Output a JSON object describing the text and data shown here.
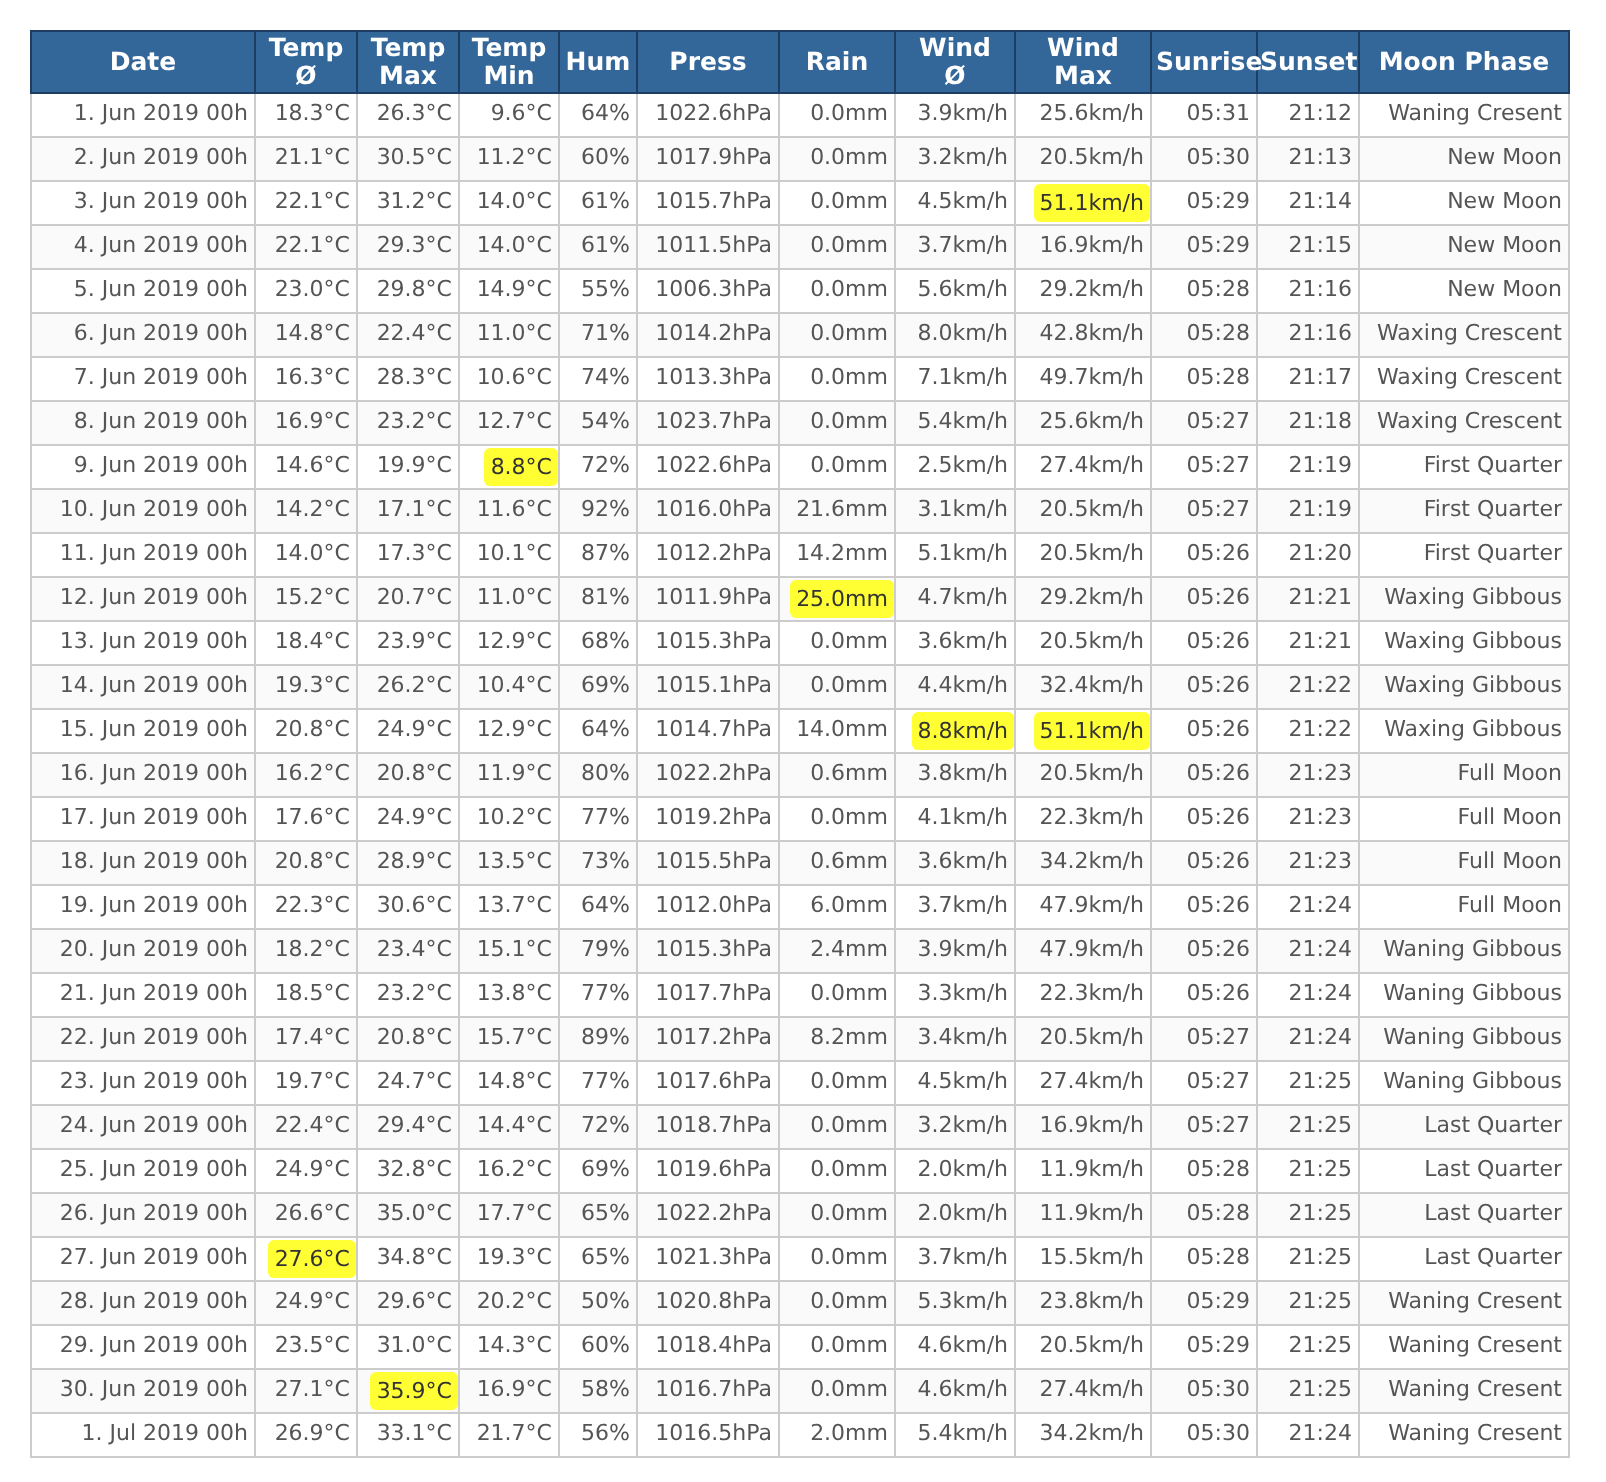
{
  "table": {
    "columns": [
      "Date",
      "Temp Ø",
      "Temp Max",
      "Temp Min",
      "Hum",
      "Press",
      "Rain",
      "Wind Ø",
      "Wind Max",
      "Sunrise",
      "Sunset",
      "Moon Phase"
    ],
    "rows": [
      {
        "cells": [
          "1. Jun 2019 00h",
          "18.3°C",
          "26.3°C",
          "9.6°C",
          "64%",
          "1022.6hPa",
          "0.0mm",
          "3.9km/h",
          "25.6km/h",
          "05:31",
          "21:12",
          "Waning Cresent"
        ]
      },
      {
        "cells": [
          "2. Jun 2019 00h",
          "21.1°C",
          "30.5°C",
          "11.2°C",
          "60%",
          "1017.9hPa",
          "0.0mm",
          "3.2km/h",
          "20.5km/h",
          "05:30",
          "21:13",
          "New Moon"
        ]
      },
      {
        "cells": [
          "3. Jun 2019 00h",
          "22.1°C",
          "31.2°C",
          "14.0°C",
          "61%",
          "1015.7hPa",
          "0.0mm",
          "4.5km/h",
          {
            "text": "51.1km/h",
            "highlighted": true
          },
          "05:29",
          "21:14",
          "New Moon"
        ]
      },
      {
        "cells": [
          "4. Jun 2019 00h",
          "22.1°C",
          "29.3°C",
          "14.0°C",
          "61%",
          "1011.5hPa",
          "0.0mm",
          "3.7km/h",
          "16.9km/h",
          "05:29",
          "21:15",
          "New Moon"
        ]
      },
      {
        "cells": [
          "5. Jun 2019 00h",
          "23.0°C",
          "29.8°C",
          "14.9°C",
          "55%",
          "1006.3hPa",
          "0.0mm",
          "5.6km/h",
          "29.2km/h",
          "05:28",
          "21:16",
          "New Moon"
        ]
      },
      {
        "cells": [
          "6. Jun 2019 00h",
          "14.8°C",
          "22.4°C",
          "11.0°C",
          "71%",
          "1014.2hPa",
          "0.0mm",
          "8.0km/h",
          "42.8km/h",
          "05:28",
          "21:16",
          "Waxing Crescent"
        ]
      },
      {
        "cells": [
          "7. Jun 2019 00h",
          "16.3°C",
          "28.3°C",
          "10.6°C",
          "74%",
          "1013.3hPa",
          "0.0mm",
          "7.1km/h",
          "49.7km/h",
          "05:28",
          "21:17",
          "Waxing Crescent"
        ]
      },
      {
        "cells": [
          "8. Jun 2019 00h",
          "16.9°C",
          "23.2°C",
          "12.7°C",
          "54%",
          "1023.7hPa",
          "0.0mm",
          "5.4km/h",
          "25.6km/h",
          "05:27",
          "21:18",
          "Waxing Crescent"
        ]
      },
      {
        "cells": [
          "9. Jun 2019 00h",
          "14.6°C",
          "19.9°C",
          {
            "text": "8.8°C",
            "highlighted": true
          },
          "72%",
          "1022.6hPa",
          "0.0mm",
          "2.5km/h",
          "27.4km/h",
          "05:27",
          "21:19",
          "First Quarter"
        ]
      },
      {
        "cells": [
          "10. Jun 2019 00h",
          "14.2°C",
          "17.1°C",
          "11.6°C",
          "92%",
          "1016.0hPa",
          "21.6mm",
          "3.1km/h",
          "20.5km/h",
          "05:27",
          "21:19",
          "First Quarter"
        ]
      },
      {
        "cells": [
          "11. Jun 2019 00h",
          "14.0°C",
          "17.3°C",
          "10.1°C",
          "87%",
          "1012.2hPa",
          "14.2mm",
          "5.1km/h",
          "20.5km/h",
          "05:26",
          "21:20",
          "First Quarter"
        ]
      },
      {
        "cells": [
          "12. Jun 2019 00h",
          "15.2°C",
          "20.7°C",
          "11.0°C",
          "81%",
          "1011.9hPa",
          {
            "text": "25.0mm",
            "highlighted": true
          },
          "4.7km/h",
          "29.2km/h",
          "05:26",
          "21:21",
          "Waxing Gibbous"
        ]
      },
      {
        "cells": [
          "13. Jun 2019 00h",
          "18.4°C",
          "23.9°C",
          "12.9°C",
          "68%",
          "1015.3hPa",
          "0.0mm",
          "3.6km/h",
          "20.5km/h",
          "05:26",
          "21:21",
          "Waxing Gibbous"
        ]
      },
      {
        "cells": [
          "14. Jun 2019 00h",
          "19.3°C",
          "26.2°C",
          "10.4°C",
          "69%",
          "1015.1hPa",
          "0.0mm",
          "4.4km/h",
          "32.4km/h",
          "05:26",
          "21:22",
          "Waxing Gibbous"
        ]
      },
      {
        "cells": [
          "15. Jun 2019 00h",
          "20.8°C",
          "24.9°C",
          "12.9°C",
          "64%",
          "1014.7hPa",
          "14.0mm",
          {
            "text": "8.8km/h",
            "highlighted": true
          },
          {
            "text": "51.1km/h",
            "highlighted": true
          },
          "05:26",
          "21:22",
          "Waxing Gibbous"
        ]
      },
      {
        "cells": [
          "16. Jun 2019 00h",
          "16.2°C",
          "20.8°C",
          "11.9°C",
          "80%",
          "1022.2hPa",
          "0.6mm",
          "3.8km/h",
          "20.5km/h",
          "05:26",
          "21:23",
          "Full Moon"
        ]
      },
      {
        "cells": [
          "17. Jun 2019 00h",
          "17.6°C",
          "24.9°C",
          "10.2°C",
          "77%",
          "1019.2hPa",
          "0.0mm",
          "4.1km/h",
          "22.3km/h",
          "05:26",
          "21:23",
          "Full Moon"
        ]
      },
      {
        "cells": [
          "18. Jun 2019 00h",
          "20.8°C",
          "28.9°C",
          "13.5°C",
          "73%",
          "1015.5hPa",
          "0.6mm",
          "3.6km/h",
          "34.2km/h",
          "05:26",
          "21:23",
          "Full Moon"
        ]
      },
      {
        "cells": [
          "19. Jun 2019 00h",
          "22.3°C",
          "30.6°C",
          "13.7°C",
          "64%",
          "1012.0hPa",
          "6.0mm",
          "3.7km/h",
          "47.9km/h",
          "05:26",
          "21:24",
          "Full Moon"
        ]
      },
      {
        "cells": [
          "20. Jun 2019 00h",
          "18.2°C",
          "23.4°C",
          "15.1°C",
          "79%",
          "1015.3hPa",
          "2.4mm",
          "3.9km/h",
          "47.9km/h",
          "05:26",
          "21:24",
          "Waning Gibbous"
        ]
      },
      {
        "cells": [
          "21. Jun 2019 00h",
          "18.5°C",
          "23.2°C",
          "13.8°C",
          "77%",
          "1017.7hPa",
          "0.0mm",
          "3.3km/h",
          "22.3km/h",
          "05:26",
          "21:24",
          "Waning Gibbous"
        ]
      },
      {
        "cells": [
          "22. Jun 2019 00h",
          "17.4°C",
          "20.8°C",
          "15.7°C",
          "89%",
          "1017.2hPa",
          "8.2mm",
          "3.4km/h",
          "20.5km/h",
          "05:27",
          "21:24",
          "Waning Gibbous"
        ]
      },
      {
        "cells": [
          "23. Jun 2019 00h",
          "19.7°C",
          "24.7°C",
          "14.8°C",
          "77%",
          "1017.6hPa",
          "0.0mm",
          "4.5km/h",
          "27.4km/h",
          "05:27",
          "21:25",
          "Waning Gibbous"
        ]
      },
      {
        "cells": [
          "24. Jun 2019 00h",
          "22.4°C",
          "29.4°C",
          "14.4°C",
          "72%",
          "1018.7hPa",
          "0.0mm",
          "3.2km/h",
          "16.9km/h",
          "05:27",
          "21:25",
          "Last Quarter"
        ]
      },
      {
        "cells": [
          "25. Jun 2019 00h",
          "24.9°C",
          "32.8°C",
          "16.2°C",
          "69%",
          "1019.6hPa",
          "0.0mm",
          "2.0km/h",
          "11.9km/h",
          "05:28",
          "21:25",
          "Last Quarter"
        ]
      },
      {
        "cells": [
          "26. Jun 2019 00h",
          "26.6°C",
          "35.0°C",
          "17.7°C",
          "65%",
          "1022.2hPa",
          "0.0mm",
          "2.0km/h",
          "11.9km/h",
          "05:28",
          "21:25",
          "Last Quarter"
        ]
      },
      {
        "cells": [
          "27. Jun 2019 00h",
          {
            "text": "27.6°C",
            "highlighted": true
          },
          "34.8°C",
          "19.3°C",
          "65%",
          "1021.3hPa",
          "0.0mm",
          "3.7km/h",
          "15.5km/h",
          "05:28",
          "21:25",
          "Last Quarter"
        ]
      },
      {
        "cells": [
          "28. Jun 2019 00h",
          "24.9°C",
          "29.6°C",
          "20.2°C",
          "50%",
          "1020.8hPa",
          "0.0mm",
          "5.3km/h",
          "23.8km/h",
          "05:29",
          "21:25",
          "Waning Cresent"
        ]
      },
      {
        "cells": [
          "29. Jun 2019 00h",
          "23.5°C",
          "31.0°C",
          "14.3°C",
          "60%",
          "1018.4hPa",
          "0.0mm",
          "4.6km/h",
          "20.5km/h",
          "05:29",
          "21:25",
          "Waning Cresent"
        ]
      },
      {
        "cells": [
          "30. Jun 2019 00h",
          "27.1°C",
          {
            "text": "35.9°C",
            "highlighted": true
          },
          "16.9°C",
          "58%",
          "1016.7hPa",
          "0.0mm",
          "4.6km/h",
          "27.4km/h",
          "05:30",
          "21:25",
          "Waning Cresent"
        ]
      },
      {
        "cells": [
          "1. Jul 2019 00h",
          "26.9°C",
          "33.1°C",
          "21.7°C",
          "56%",
          "1016.5hPa",
          "2.0mm",
          "5.4km/h",
          "34.2km/h",
          "05:30",
          "21:24",
          "Waning Cresent"
        ]
      }
    ]
  }
}
